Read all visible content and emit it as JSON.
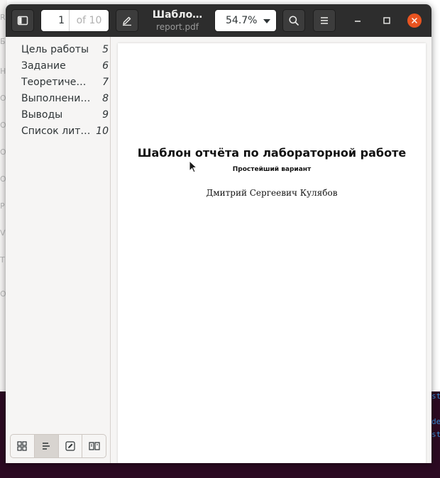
{
  "window": {
    "title": "Шабло…",
    "filename": "report.pdf"
  },
  "toolbar": {
    "page_number": "1",
    "page_of": "of 10",
    "zoom": "54.7%"
  },
  "outline": [
    {
      "title": "Цель работы",
      "page": "5"
    },
    {
      "title": "Задание",
      "page": "6"
    },
    {
      "title": "Теоретичес…",
      "page": "7"
    },
    {
      "title": "Выполнени…",
      "page": "8"
    },
    {
      "title": "Выводы",
      "page": "9"
    },
    {
      "title": "Список лит…",
      "page": "10"
    }
  ],
  "document": {
    "title": "Шаблон отчёта по лабораторной работе",
    "subtitle": "Простейший вариант",
    "author": "Дмитрий Сергеевич Кулябов"
  },
  "background": {
    "left_letters": [
      "R",
      "Б",
      "Н",
      "О",
      "О",
      "О",
      "О",
      "М",
      "Р",
      "V",
      "Т",
      "О"
    ],
    "right_letters": [
      "st",
      "de",
      "st"
    ]
  },
  "colors": {
    "headerbar": "#2d2d2d",
    "close": "#e95420",
    "desktop": "#2c0a22",
    "terminal_text": "#3a8fd8"
  }
}
